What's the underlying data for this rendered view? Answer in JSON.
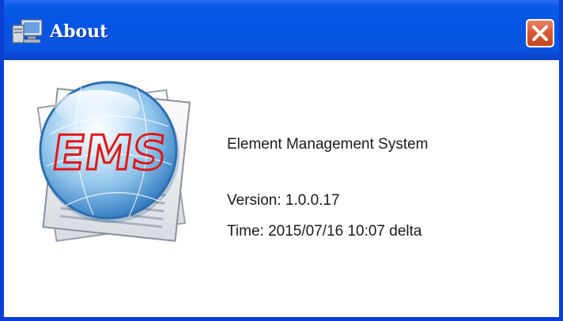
{
  "window": {
    "title": "About",
    "icon": "computer-icon",
    "close_icon": "close-icon"
  },
  "logo": {
    "text": "EMS"
  },
  "about": {
    "product_name": "Element Management System",
    "version": "Version: 1.0.0.17",
    "time": "Time: 2015/07/16 10:07 delta"
  },
  "colors": {
    "titlebar": "#0454e3",
    "close_button": "#d95a33",
    "logo_text": "#e01818"
  }
}
